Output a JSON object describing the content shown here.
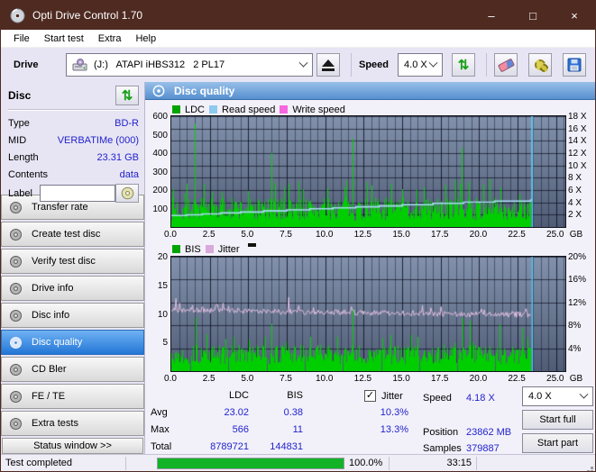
{
  "window": {
    "title": "Opti Drive Control 1.70",
    "controls": {
      "minimize": "–",
      "maximize": "□",
      "close": "×"
    }
  },
  "menu": {
    "items": [
      "File",
      "Start test",
      "Extra",
      "Help"
    ]
  },
  "toolbar": {
    "drive_label": "Drive",
    "drive_value": "(J:)   ATAPI iHBS312   2 PL17",
    "speed_label": "Speed",
    "speed_value": "4.0 X"
  },
  "disc_panel": {
    "title": "Disc",
    "fields": [
      {
        "label": "Type",
        "value": "BD-R"
      },
      {
        "label": "MID",
        "value": "VERBATIMe (000)"
      },
      {
        "label": "Length",
        "value": "23.31 GB"
      },
      {
        "label": "Contents",
        "value": "data"
      }
    ],
    "label_field": {
      "label": "Label",
      "value": ""
    }
  },
  "nav": {
    "items": [
      "Transfer rate",
      "Create test disc",
      "Verify test disc",
      "Drive info",
      "Disc info",
      "Disc quality",
      "CD Bler",
      "FE / TE",
      "Extra tests"
    ],
    "selected_index": 5,
    "status_window_label": "Status window >>"
  },
  "content_header": {
    "title": "Disc quality"
  },
  "stats": {
    "col_headers": [
      "LDC",
      "BIS"
    ],
    "jitter_checkbox": {
      "label": "Jitter",
      "checked": true,
      "checkmark": "✓"
    },
    "rows": [
      {
        "label": "Avg",
        "ldc": "23.02",
        "bis": "0.38",
        "jitter": "10.3%"
      },
      {
        "label": "Max",
        "ldc": "566",
        "bis": "11",
        "jitter": "13.3%"
      },
      {
        "label": "Total",
        "ldc": "8789721",
        "bis": "144831",
        "jitter": ""
      }
    ],
    "right_fields": [
      {
        "label": "Speed",
        "value": "4.18 X"
      },
      {
        "label": "Position",
        "value": "23862 MB"
      },
      {
        "label": "Samples",
        "value": "379887"
      }
    ],
    "speed_select": "4.0 X",
    "start_full_label": "Start full",
    "start_part_label": "Start part"
  },
  "statusbar": {
    "status": "Test completed",
    "progress_percent": 100,
    "percent_label": "100.0%",
    "time": "33:15"
  },
  "colors": {
    "titlebar": "#4e2a21",
    "header_blue": "#568fd0",
    "value_blue": "#2222cc",
    "plot_bg_top": "#8292ac",
    "plot_bg_bottom": "#505c76",
    "ldc_green": "#00ce00",
    "read_speed_blue": "#aadcf7",
    "write_speed_pink": "#f566e0",
    "jitter_plum": "#debddd",
    "end_marker_cyan": "#4fc8f5",
    "progress_green": "#12b326"
  },
  "chart_data": [
    {
      "type": "bar",
      "title": "LDC / Read speed / Write speed vs disc position",
      "legend": [
        {
          "label": "LDC",
          "color": "#00a400"
        },
        {
          "label": "Read speed",
          "color": "#8ec9ef"
        },
        {
          "label": "Write speed",
          "color": "#f566e0"
        }
      ],
      "x_range": [
        0,
        25.6
      ],
      "x_ticks": [
        0,
        2.5,
        5,
        7.5,
        10,
        12.5,
        15,
        17.5,
        20,
        22.5,
        25
      ],
      "x_tick_labels": [
        "0.0",
        "2.5",
        "5.0",
        "7.5",
        "10.0",
        "12.5",
        "15.0",
        "17.5",
        "20.0",
        "22.5",
        "25.0"
      ],
      "x_unit": "GB",
      "y_left": {
        "range": [
          0,
          600
        ],
        "ticks": [
          100,
          200,
          300,
          400,
          500,
          600
        ]
      },
      "y_right": {
        "labels": [
          "2 X",
          "4 X",
          "6 X",
          "8 X",
          "10 X",
          "12 X",
          "14 X",
          "16 X",
          "18 X"
        ],
        "values": [
          66.7,
          133.3,
          200,
          266.7,
          333.3,
          400,
          466.7,
          533.3,
          600
        ]
      },
      "hgrid": [
        66.7,
        133.3,
        200,
        266.7,
        333.3,
        400,
        466.7,
        533.3,
        600
      ],
      "data_end_x": 23.35,
      "end_marker_x": 23.45,
      "series": [
        {
          "name": "LDC",
          "kind": "spikebars",
          "color": "#00ce00",
          "step": 0.055,
          "seed": 7,
          "baseline": [
            35,
            160
          ],
          "tall_chance": 0.05,
          "tall_mult": 1.7,
          "spikes": [
            [
              0.12,
              205
            ],
            [
              0.9,
              180
            ],
            [
              1.55,
              560
            ],
            [
              2.1,
              235
            ],
            [
              3.3,
              190
            ],
            [
              5.0,
              195
            ],
            [
              6.5,
              400
            ],
            [
              7.3,
              215
            ],
            [
              8.6,
              205
            ],
            [
              10.1,
              210
            ],
            [
              11.3,
              215
            ],
            [
              11.75,
              480
            ],
            [
              13.0,
              225
            ],
            [
              14.3,
              235
            ],
            [
              15.0,
              205
            ],
            [
              16.4,
              215
            ],
            [
              17.8,
              230
            ],
            [
              18.45,
              255
            ],
            [
              18.85,
              430
            ],
            [
              19.3,
              245
            ],
            [
              20.7,
              260
            ],
            [
              21.4,
              215
            ],
            [
              22.6,
              180
            ]
          ],
          "avg": 23.02,
          "max": 566,
          "total": 8789721
        },
        {
          "name": "Read speed",
          "kind": "steps",
          "color": "#aadcf7",
          "points": [
            [
              0,
              62
            ],
            [
              1,
              66
            ],
            [
              2,
              71
            ],
            [
              3.2,
              76
            ],
            [
              4.5,
              81
            ],
            [
              6,
              87
            ],
            [
              7.5,
              93
            ],
            [
              9,
              99
            ],
            [
              10.5,
              104
            ],
            [
              12,
              109
            ],
            [
              13.5,
              114
            ],
            [
              15,
              121
            ],
            [
              17,
              128
            ],
            [
              19,
              134
            ],
            [
              21,
              140
            ],
            [
              23.35,
              146
            ],
            [
              23.45,
              600
            ]
          ],
          "avg_speed_x": 4.18
        },
        {
          "name": "Write speed",
          "kind": "none",
          "color": "#f566e0"
        }
      ]
    },
    {
      "type": "bar",
      "title": "BIS / Jitter vs disc position",
      "legend": [
        {
          "label": "BIS",
          "color": "#00a400"
        },
        {
          "label": "Jitter",
          "color": "#d9a9d9"
        }
      ],
      "x_range": [
        0,
        25.6
      ],
      "x_ticks": [
        0,
        2.5,
        5,
        7.5,
        10,
        12.5,
        15,
        17.5,
        20,
        22.5,
        25
      ],
      "x_tick_labels": [
        "0.0",
        "2.5",
        "5.0",
        "7.5",
        "10.0",
        "12.5",
        "15.0",
        "17.5",
        "20.0",
        "22.5",
        "25.0"
      ],
      "x_unit": "GB",
      "y_left": {
        "range": [
          0,
          20
        ],
        "ticks": [
          5,
          10,
          15,
          20
        ]
      },
      "y_right": {
        "labels": [
          "4%",
          "8%",
          "12%",
          "16%",
          "20%"
        ],
        "values": [
          4,
          8,
          12,
          16,
          20
        ]
      },
      "hgrid": [
        4,
        8,
        12,
        16,
        20
      ],
      "data_end_x": 23.35,
      "end_marker_x": 23.45,
      "series": [
        {
          "name": "BIS",
          "kind": "spikebars",
          "color": "#00ce00",
          "step": 0.06,
          "seed": 13,
          "baseline": [
            1.2,
            4.6
          ],
          "tall_chance": 0.07,
          "tall_mult": 1.5,
          "spikes": [
            [
              1.55,
              9.4
            ],
            [
              2.3,
              6.4
            ],
            [
              4.0,
              6.0
            ],
            [
              6.5,
              8.3
            ],
            [
              9.0,
              6.0
            ],
            [
              11.75,
              10.8
            ],
            [
              14.2,
              6.3
            ],
            [
              16.0,
              6.0
            ],
            [
              18.9,
              9.3
            ],
            [
              19.4,
              8.8
            ],
            [
              21.3,
              8.2
            ],
            [
              22.8,
              7.6
            ]
          ],
          "avg": 0.38,
          "max": 11,
          "total": 144831
        },
        {
          "name": "Jitter",
          "kind": "noisyline",
          "color": "#debddd",
          "seed": 21,
          "step": 0.06,
          "start": 10.7,
          "end": 9.8,
          "noise": 0.5,
          "spikes": [
            [
              0.3,
              12.7
            ],
            [
              7.6,
              12.9
            ]
          ],
          "avg": "10.3%",
          "max": "13.3%"
        }
      ]
    }
  ]
}
